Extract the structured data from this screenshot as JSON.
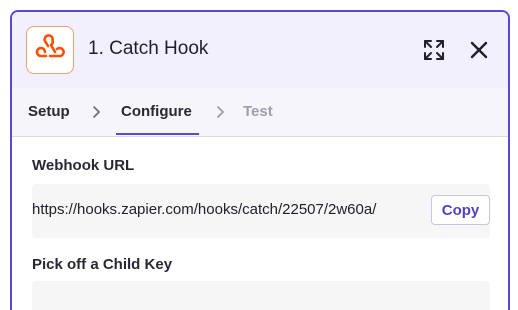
{
  "header": {
    "step_title": "1. Catch Hook",
    "app_icon": "webhook-icon",
    "accent_color": "#ff4f00"
  },
  "tabs": [
    {
      "label": "Setup",
      "state": "completed"
    },
    {
      "label": "Configure",
      "state": "active"
    },
    {
      "label": "Test",
      "state": "disabled"
    }
  ],
  "webhook": {
    "label": "Webhook URL",
    "url": "https://hooks.zapier.com/hooks/catch/22507/2w60a/",
    "copy_label": "Copy"
  },
  "child_key": {
    "label": "Pick off a Child Key",
    "value": ""
  },
  "colors": {
    "border": "#5b48d6",
    "header_bg": "#f2f0fc",
    "link": "#4f42c4"
  }
}
